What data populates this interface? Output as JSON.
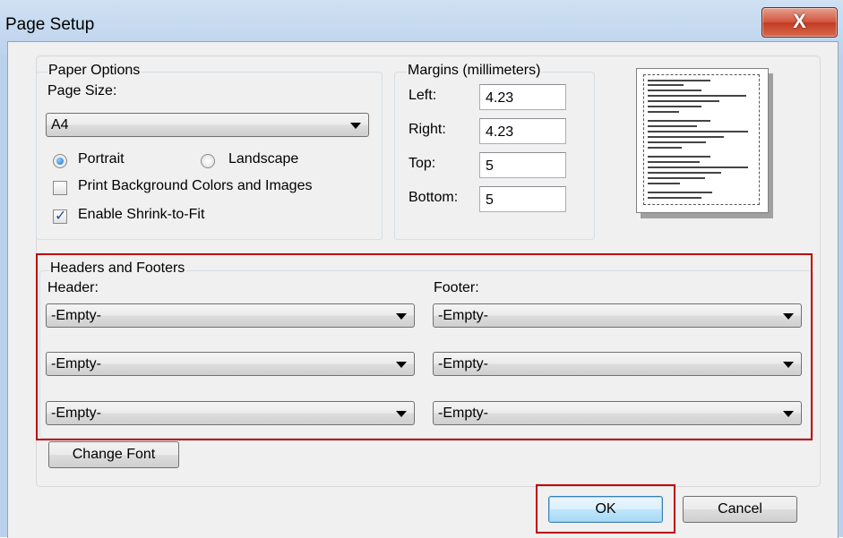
{
  "window": {
    "title": "Page Setup",
    "close_label": "X"
  },
  "paper_options": {
    "legend": "Paper Options",
    "page_size_label": "Page Size:",
    "page_size_value": "A4",
    "portrait_label": "Portrait",
    "landscape_label": "Landscape",
    "orientation_selected": "Portrait",
    "print_background_label": "Print Background Colors and Images",
    "print_background_checked": false,
    "shrink_to_fit_label": "Enable Shrink-to-Fit",
    "shrink_to_fit_checked": true
  },
  "margins": {
    "legend": "Margins (millimeters)",
    "left_label": "Left:",
    "left_value": "4.23",
    "right_label": "Right:",
    "right_value": "4.23",
    "top_label": "Top:",
    "top_value": "5",
    "bottom_label": "Bottom:",
    "bottom_value": "5"
  },
  "headers_footers": {
    "legend": "Headers and Footers",
    "header_label": "Header:",
    "footer_label": "Footer:",
    "header_values": [
      "-Empty-",
      "-Empty-",
      "-Empty-"
    ],
    "footer_values": [
      "-Empty-",
      "-Empty-",
      "-Empty-"
    ]
  },
  "buttons": {
    "change_font": "Change Font",
    "ok": "OK",
    "cancel": "Cancel"
  },
  "colors": {
    "highlight": "#c00000",
    "title_bar": "#bcd3ec",
    "dialog_bg": "#f0f0f0"
  }
}
